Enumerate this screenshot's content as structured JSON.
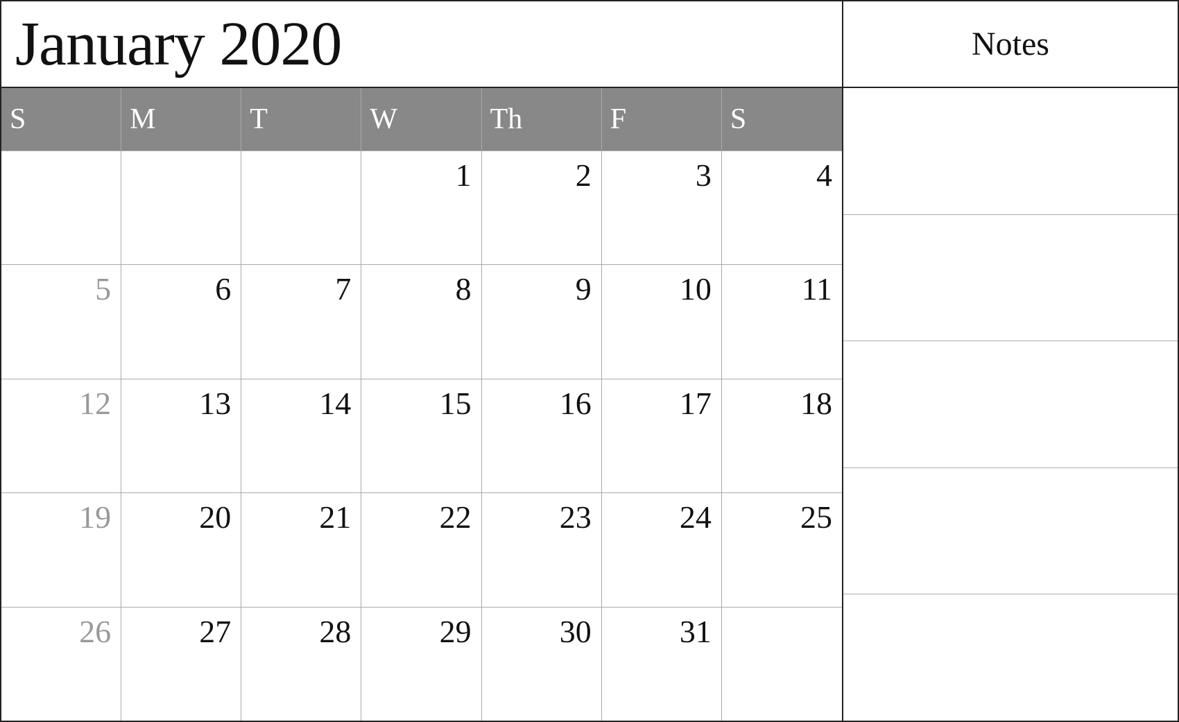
{
  "header": {
    "month_title": "January 2020",
    "notes_label": "Notes"
  },
  "day_headers": [
    "S",
    "M",
    "T",
    "W",
    "Th",
    "F",
    "S"
  ],
  "weeks": [
    [
      {
        "num": "",
        "empty": true
      },
      {
        "num": "",
        "empty": true
      },
      {
        "num": "",
        "empty": true
      },
      {
        "num": "1",
        "empty": false
      },
      {
        "num": "2",
        "empty": false
      },
      {
        "num": "3",
        "empty": false
      },
      {
        "num": "4",
        "empty": false
      }
    ],
    [
      {
        "num": "5",
        "empty": false,
        "sunday": true
      },
      {
        "num": "6",
        "empty": false
      },
      {
        "num": "7",
        "empty": false
      },
      {
        "num": "8",
        "empty": false
      },
      {
        "num": "9",
        "empty": false
      },
      {
        "num": "10",
        "empty": false
      },
      {
        "num": "11",
        "empty": false
      }
    ],
    [
      {
        "num": "12",
        "empty": false,
        "sunday": true
      },
      {
        "num": "13",
        "empty": false
      },
      {
        "num": "14",
        "empty": false
      },
      {
        "num": "15",
        "empty": false
      },
      {
        "num": "16",
        "empty": false
      },
      {
        "num": "17",
        "empty": false
      },
      {
        "num": "18",
        "empty": false
      }
    ],
    [
      {
        "num": "19",
        "empty": false,
        "sunday": true
      },
      {
        "num": "20",
        "empty": false
      },
      {
        "num": "21",
        "empty": false
      },
      {
        "num": "22",
        "empty": false
      },
      {
        "num": "23",
        "empty": false
      },
      {
        "num": "24",
        "empty": false
      },
      {
        "num": "25",
        "empty": false
      }
    ],
    [
      {
        "num": "26",
        "empty": false,
        "sunday": true
      },
      {
        "num": "27",
        "empty": false
      },
      {
        "num": "28",
        "empty": false
      },
      {
        "num": "29",
        "empty": false
      },
      {
        "num": "30",
        "empty": false
      },
      {
        "num": "31",
        "empty": false
      },
      {
        "num": "",
        "empty": true
      }
    ]
  ]
}
